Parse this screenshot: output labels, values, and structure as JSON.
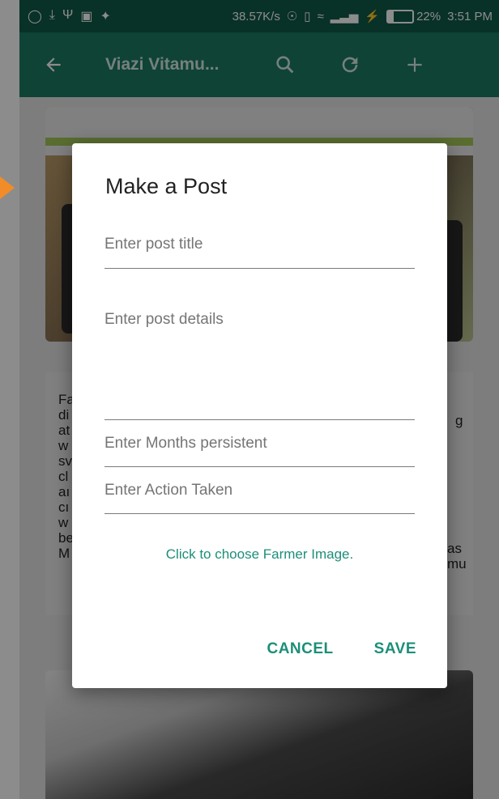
{
  "statusbar": {
    "left_icons": [
      "shield-icon",
      "download-icon",
      "usb-icon",
      "image-icon",
      "twitter-icon"
    ],
    "net_speed": "38.57K/s",
    "battery": "22%",
    "battery_level": 0.22,
    "time": "3:51 PM"
  },
  "toolbar": {
    "title": "Viazi Vitamu..."
  },
  "background": {
    "card_text_lines": [
      "Fa",
      "di",
      "at",
      "w",
      "sv",
      "cl",
      "aı",
      "cı",
      "w",
      "be",
      "M"
    ],
    "card_text_right": [
      "g",
      "as",
      "mu"
    ]
  },
  "dialog": {
    "title": "Make a Post",
    "title_field_placeholder": "Enter post title",
    "details_field_placeholder": "Enter post details",
    "months_field_placeholder": "Enter Months persistent",
    "action_field_placeholder": "Enter Action Taken",
    "choose_image_link": "Click to choose Farmer Image.",
    "cancel_label": "CANCEL",
    "save_label": "SAVE"
  },
  "colors": {
    "statusbar": "#0f5a48",
    "toolbar": "#1a7a63",
    "accent": "#1c8f79",
    "arrow": "#f28c28"
  }
}
